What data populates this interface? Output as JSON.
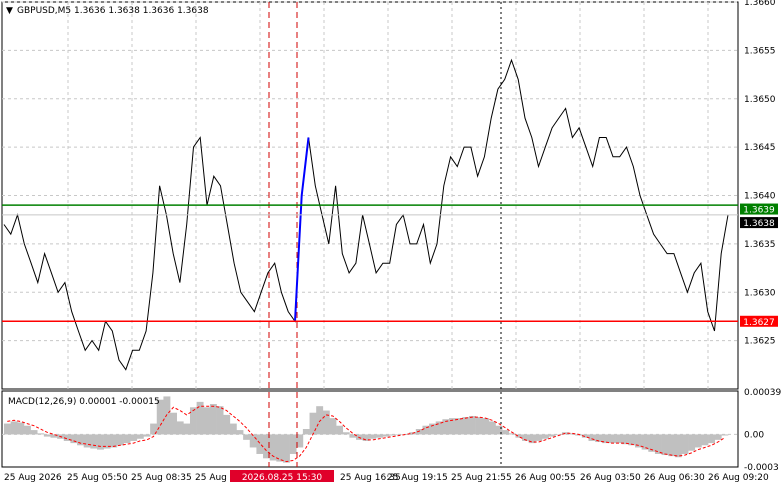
{
  "header": {
    "symbol_line": "GBPUSD,M5  1.3636 1.3638 1.3636 1.3638"
  },
  "macd_header": "MACD(12,26,9) 0.00001 -0.00015",
  "colors": {
    "price_line": "#000000",
    "impulse": "#0000ff",
    "resistance": "#008000",
    "support": "#ff0000",
    "macd_hist": "#c0c0c0",
    "macd_signal": "#ff0000",
    "grid": "#c8c8c8",
    "current_tag": "#000000"
  },
  "levels": {
    "resistance": {
      "value": 1.3639,
      "label": "1.3639"
    },
    "support": {
      "value": 1.3627,
      "label": "1.3627"
    },
    "current": {
      "value": 1.3638,
      "label": "1.3638"
    }
  },
  "highlight_time_label": "2026.08.25 15:30",
  "chart_data": {
    "type": "line",
    "title": "GBPUSD,M5",
    "price_axis": {
      "ylim": [
        1.362,
        1.366
      ],
      "ticks": [
        "1.3660",
        "1.3655",
        "1.3650",
        "1.3645",
        "1.3640",
        "1.3635",
        "1.3630",
        "1.3625"
      ]
    },
    "time_axis_labels": [
      "25 Aug 2026",
      "25 Aug 05:50",
      "25 Aug 08:35",
      "25 Aug",
      "25 Aug 16:35",
      "25 Aug 19:15",
      "25 Aug 21:55",
      "26 Aug 00:55",
      "26 Aug 03:50",
      "26 Aug 06:30",
      "26 Aug 09:20"
    ],
    "price_series": [
      1.3637,
      1.3636,
      1.3638,
      1.3635,
      1.3633,
      1.3631,
      1.3634,
      1.3632,
      1.363,
      1.3631,
      1.3628,
      1.3626,
      1.3624,
      1.3625,
      1.3624,
      1.3627,
      1.3626,
      1.3623,
      1.3622,
      1.3624,
      1.3624,
      1.3626,
      1.3632,
      1.3641,
      1.3638,
      1.3634,
      1.3631,
      1.3637,
      1.3645,
      1.3646,
      1.3639,
      1.3642,
      1.3641,
      1.3637,
      1.3633,
      1.363,
      1.3629,
      1.3628,
      1.363,
      1.3632,
      1.3633,
      1.363,
      1.3628,
      1.3627,
      1.364,
      1.3646,
      1.3641,
      1.3638,
      1.3635,
      1.3641,
      1.3634,
      1.3632,
      1.3633,
      1.3638,
      1.3635,
      1.3632,
      1.3633,
      1.3633,
      1.3637,
      1.3638,
      1.3635,
      1.3635,
      1.3637,
      1.3633,
      1.3635,
      1.3641,
      1.3644,
      1.3643,
      1.3645,
      1.3645,
      1.3642,
      1.3644,
      1.3648,
      1.3651,
      1.3652,
      1.3654,
      1.3652,
      1.3648,
      1.3646,
      1.3643,
      1.3645,
      1.3647,
      1.3648,
      1.3649,
      1.3646,
      1.3647,
      1.3645,
      1.3643,
      1.3646,
      1.3646,
      1.3644,
      1.3644,
      1.3645,
      1.3643,
      1.364,
      1.3638,
      1.3636,
      1.3635,
      1.3634,
      1.3634,
      1.3632,
      1.363,
      1.3632,
      1.3633,
      1.3628,
      1.3626,
      1.3634,
      1.3638
    ],
    "macd": {
      "ylim": [
        -0.0003,
        0.0004
      ],
      "ticks": [
        "0.00039",
        "0.00",
        "-0.0003"
      ],
      "histogram": [
        0.0001,
        0.00012,
        0.00011,
        8e-05,
        4e-05,
        1e-05,
        -2e-05,
        -3e-05,
        -4e-05,
        -6e-05,
        -8e-05,
        -0.0001,
        -0.00012,
        -0.00013,
        -0.00014,
        -0.00013,
        -0.00012,
        -0.0001,
        -8e-05,
        -6e-05,
        -4e-05,
        -2e-05,
        0.0001,
        0.00032,
        0.00035,
        0.0002,
        0.00012,
        0.0001,
        0.00025,
        0.0003,
        0.00025,
        0.00028,
        0.00026,
        0.00018,
        0.0001,
        4e-05,
        -5e-05,
        -0.00012,
        -0.00018,
        -0.00022,
        -0.00024,
        -0.00025,
        -0.00026,
        -0.00018,
        -0.00012,
        5e-05,
        0.0002,
        0.00026,
        0.00022,
        0.00015,
        8e-05,
        2e-05,
        -3e-05,
        -5e-05,
        -6e-05,
        -4e-05,
        -3e-05,
        -2e-05,
        -1e-05,
        0.0,
        0.0,
        2e-05,
        5e-05,
        8e-05,
        0.0001,
        0.00012,
        0.00014,
        0.00015,
        0.00015,
        0.00016,
        0.00017,
        0.00016,
        0.00015,
        0.00012,
        8e-05,
        4e-05,
        1e-05,
        -3e-05,
        -6e-05,
        -8e-05,
        -6e-05,
        -4e-05,
        -2e-05,
        0.0,
        2e-05,
        1e-05,
        -1e-05,
        -3e-05,
        -6e-05,
        -7e-05,
        -8e-05,
        -8e-05,
        -8e-05,
        -9e-05,
        -0.0001,
        -0.00012,
        -0.00014,
        -0.00016,
        -0.00018,
        -0.00019,
        -0.0002,
        -0.00021,
        -0.00018,
        -0.00015,
        -0.00012,
        -0.0001,
        -8e-05,
        -5e-05,
        -1e-05
      ],
      "signal": [
        0.00012,
        0.00013,
        0.00012,
        0.0001,
        8e-05,
        5e-05,
        2e-05,
        0.0,
        -2e-05,
        -4e-05,
        -6e-05,
        -8e-05,
        -9e-05,
        -0.0001,
        -0.00011,
        -0.00011,
        -0.00011,
        -0.0001,
        -9e-05,
        -8e-05,
        -6e-05,
        -5e-05,
        -2e-05,
        8e-05,
        0.00018,
        0.00025,
        0.00022,
        0.00018,
        0.00022,
        0.00026,
        0.00026,
        0.00026,
        0.00025,
        0.00022,
        0.00017,
        0.00012,
        6e-05,
        -1e-05,
        -8e-05,
        -0.00015,
        -0.0002,
        -0.00023,
        -0.00025,
        -0.00024,
        -0.0002,
        -0.00012,
        0.0,
        0.00012,
        0.00018,
        0.00017,
        0.00012,
        6e-05,
        1e-05,
        -3e-05,
        -5e-05,
        -5e-05,
        -4e-05,
        -3e-05,
        -2e-05,
        -1e-05,
        0.0,
        1e-05,
        3e-05,
        6e-05,
        8e-05,
        0.0001,
        0.00012,
        0.00013,
        0.00014,
        0.00015,
        0.00016,
        0.00016,
        0.00015,
        0.00013,
        0.0001,
        6e-05,
        2e-05,
        -2e-05,
        -5e-05,
        -7e-05,
        -7e-05,
        -5e-05,
        -3e-05,
        -1e-05,
        1e-05,
        1e-05,
        0.0,
        -2e-05,
        -4e-05,
        -6e-05,
        -7e-05,
        -8e-05,
        -8e-05,
        -8e-05,
        -9e-05,
        -0.0001,
        -0.00012,
        -0.00014,
        -0.00016,
        -0.00018,
        -0.00019,
        -0.0002,
        -0.00019,
        -0.00017,
        -0.00014,
        -0.00012,
        -0.0001,
        -7e-05,
        -3e-05
      ]
    }
  }
}
